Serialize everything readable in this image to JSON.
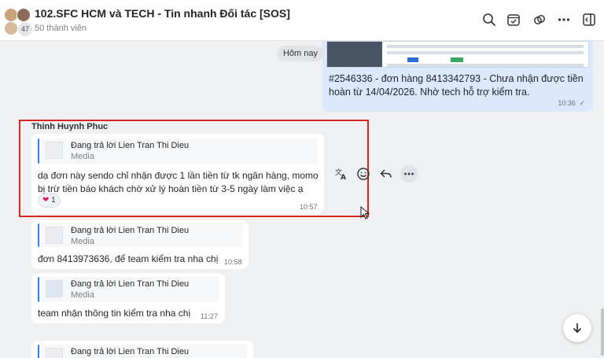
{
  "header": {
    "title": "102.SFC HCM và TECH - Tin nhanh Đối tác [SOS]",
    "members": "50 thành viên",
    "avatar_count": "47"
  },
  "chat": {
    "date_separator": "Hôm nay",
    "my_message": {
      "text": "#2546336 - đơn hàng 8413342793 - Chưa nhận được tiền hoàn từ 14/04/2026. Nhờ tech hỗ trợ kiểm tra.",
      "time": "10:36"
    },
    "sender_name": "Thinh Huynh Phuc",
    "messages": [
      {
        "reply_to": "Đang trả lời Lien Tran Thi Dieu",
        "reply_type": "Media",
        "text_line1": "dạ đơn này sendo chỉ nhận được 1 lần tiền từ tk ngân hàng, momo",
        "text_line2": "bị trừ tiền báo khách chờ xử lý hoàn tiền từ 3-5 ngày làm việc ạ",
        "reaction": "1",
        "time": "10:57"
      },
      {
        "reply_to": "Đang trả lời Lien Tran Thi Dieu",
        "reply_type": "Media",
        "text": "đơn 8413973636, để team kiểm tra nha chị",
        "time": "10:58"
      },
      {
        "reply_to": "Đang trả lời Lien Tran Thi Dieu",
        "reply_type": "Media",
        "text": "team nhận thông tin kiểm tra nha chị",
        "time": "11:27"
      },
      {
        "reply_to": "Đang trả lời Lien Tran Thi Dieu"
      }
    ]
  },
  "icons": {
    "header": [
      "search-icon",
      "calendar-check-icon",
      "link-icon",
      "more-icon",
      "sidebar-toggle-icon"
    ],
    "actions": [
      "translate-icon",
      "emoji-icon",
      "reply-icon",
      "more-icon"
    ],
    "scroll": "arrow-down-icon"
  },
  "colors": {
    "accent": "#2f80ed",
    "my_bubble": "#dbe8fd",
    "highlight": "#d9261c"
  }
}
